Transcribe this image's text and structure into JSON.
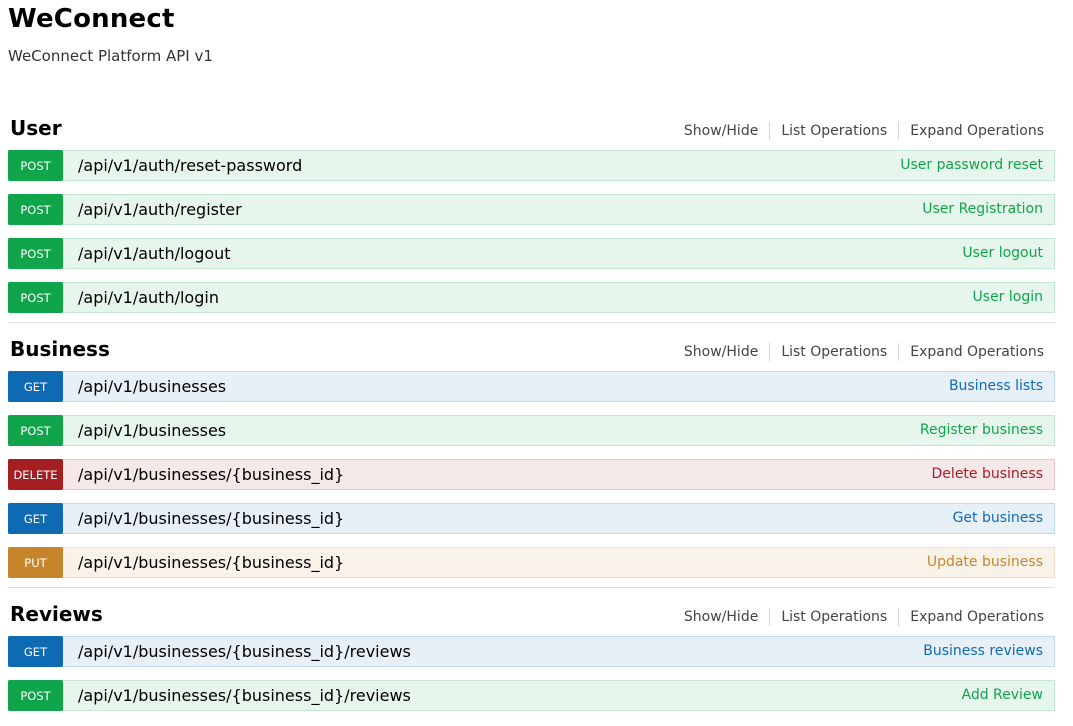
{
  "app": {
    "title": "WeConnect",
    "subtitle": "WeConnect Platform API v1"
  },
  "links": {
    "show_hide": "Show/Hide",
    "list_operations": "List Operations",
    "expand_operations": "Expand Operations"
  },
  "colors": {
    "post": "#10a54a",
    "get": "#0f6ab4",
    "delete": "#a41e22",
    "put": "#c5862b"
  },
  "sections": [
    {
      "name": "User",
      "operations": [
        {
          "method": "POST",
          "path": "/api/v1/auth/reset-password",
          "summary": "User password reset"
        },
        {
          "method": "POST",
          "path": "/api/v1/auth/register",
          "summary": "User Registration"
        },
        {
          "method": "POST",
          "path": "/api/v1/auth/logout",
          "summary": "User logout"
        },
        {
          "method": "POST",
          "path": "/api/v1/auth/login",
          "summary": "User login"
        }
      ]
    },
    {
      "name": "Business",
      "operations": [
        {
          "method": "GET",
          "path": "/api/v1/businesses",
          "summary": "Business lists"
        },
        {
          "method": "POST",
          "path": "/api/v1/businesses",
          "summary": "Register business"
        },
        {
          "method": "DELETE",
          "path": "/api/v1/businesses/{business_id}",
          "summary": "Delete business"
        },
        {
          "method": "GET",
          "path": "/api/v1/businesses/{business_id}",
          "summary": "Get business"
        },
        {
          "method": "PUT",
          "path": "/api/v1/businesses/{business_id}",
          "summary": "Update business"
        }
      ]
    },
    {
      "name": "Reviews",
      "operations": [
        {
          "method": "GET",
          "path": "/api/v1/businesses/{business_id}/reviews",
          "summary": "Business reviews"
        },
        {
          "method": "POST",
          "path": "/api/v1/businesses/{business_id}/reviews",
          "summary": "Add Review"
        }
      ]
    }
  ]
}
